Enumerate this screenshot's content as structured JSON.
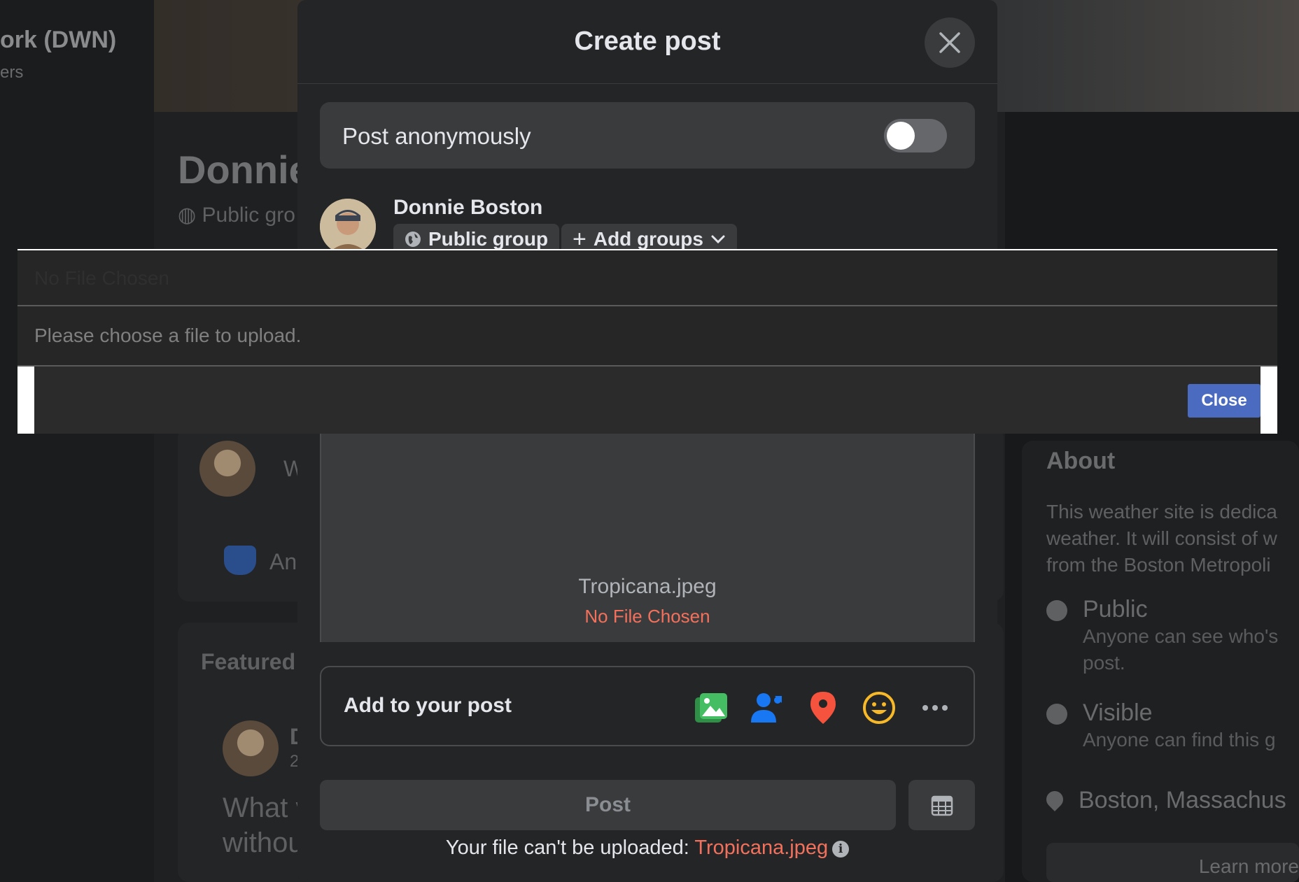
{
  "background": {
    "group_name": "ork (DWN)",
    "group_sub": "ers",
    "page_title": "Donnie",
    "privacy": "Public gro",
    "composer_placeholder": "W",
    "anon_label": "An",
    "featured": "Featured",
    "post_author_initial": "D",
    "post_meta": "2",
    "post_text_line1": "What v",
    "post_text_line2": "withou",
    "about": {
      "title": "About",
      "description": [
        "This weather site is dedica",
        "weather. It will consist of w",
        "from the Boston Metropoli"
      ],
      "public_title": "Public",
      "public_desc": [
        "Anyone can see who's",
        "post."
      ],
      "visible_title": "Visible",
      "visible_desc": "Anyone can find this g",
      "location": "Boston, Massachus",
      "learn_more": "Learn more"
    }
  },
  "modal": {
    "title": "Create post",
    "anonymous_label": "Post anonymously",
    "author_name": "Donnie Boston",
    "audience_chip": "Public group",
    "add_groups_chip": "Add groups",
    "file_name": "Tropicana.jpeg",
    "file_status": "No File Chosen",
    "add_to_post_label": "Add to your post",
    "post_button": "Post",
    "error_prefix": "Your file can't be uploaded: ",
    "error_file": "Tropicana.jpeg",
    "colors": {
      "photo": "#45bd62",
      "tag": "#1877f2",
      "location": "#f5533d",
      "feeling": "#f7b928",
      "error": "#f3715c"
    }
  },
  "file_dialog": {
    "title": "No File Chosen",
    "message": "Please choose a file to upload.",
    "close_button": "Close"
  }
}
